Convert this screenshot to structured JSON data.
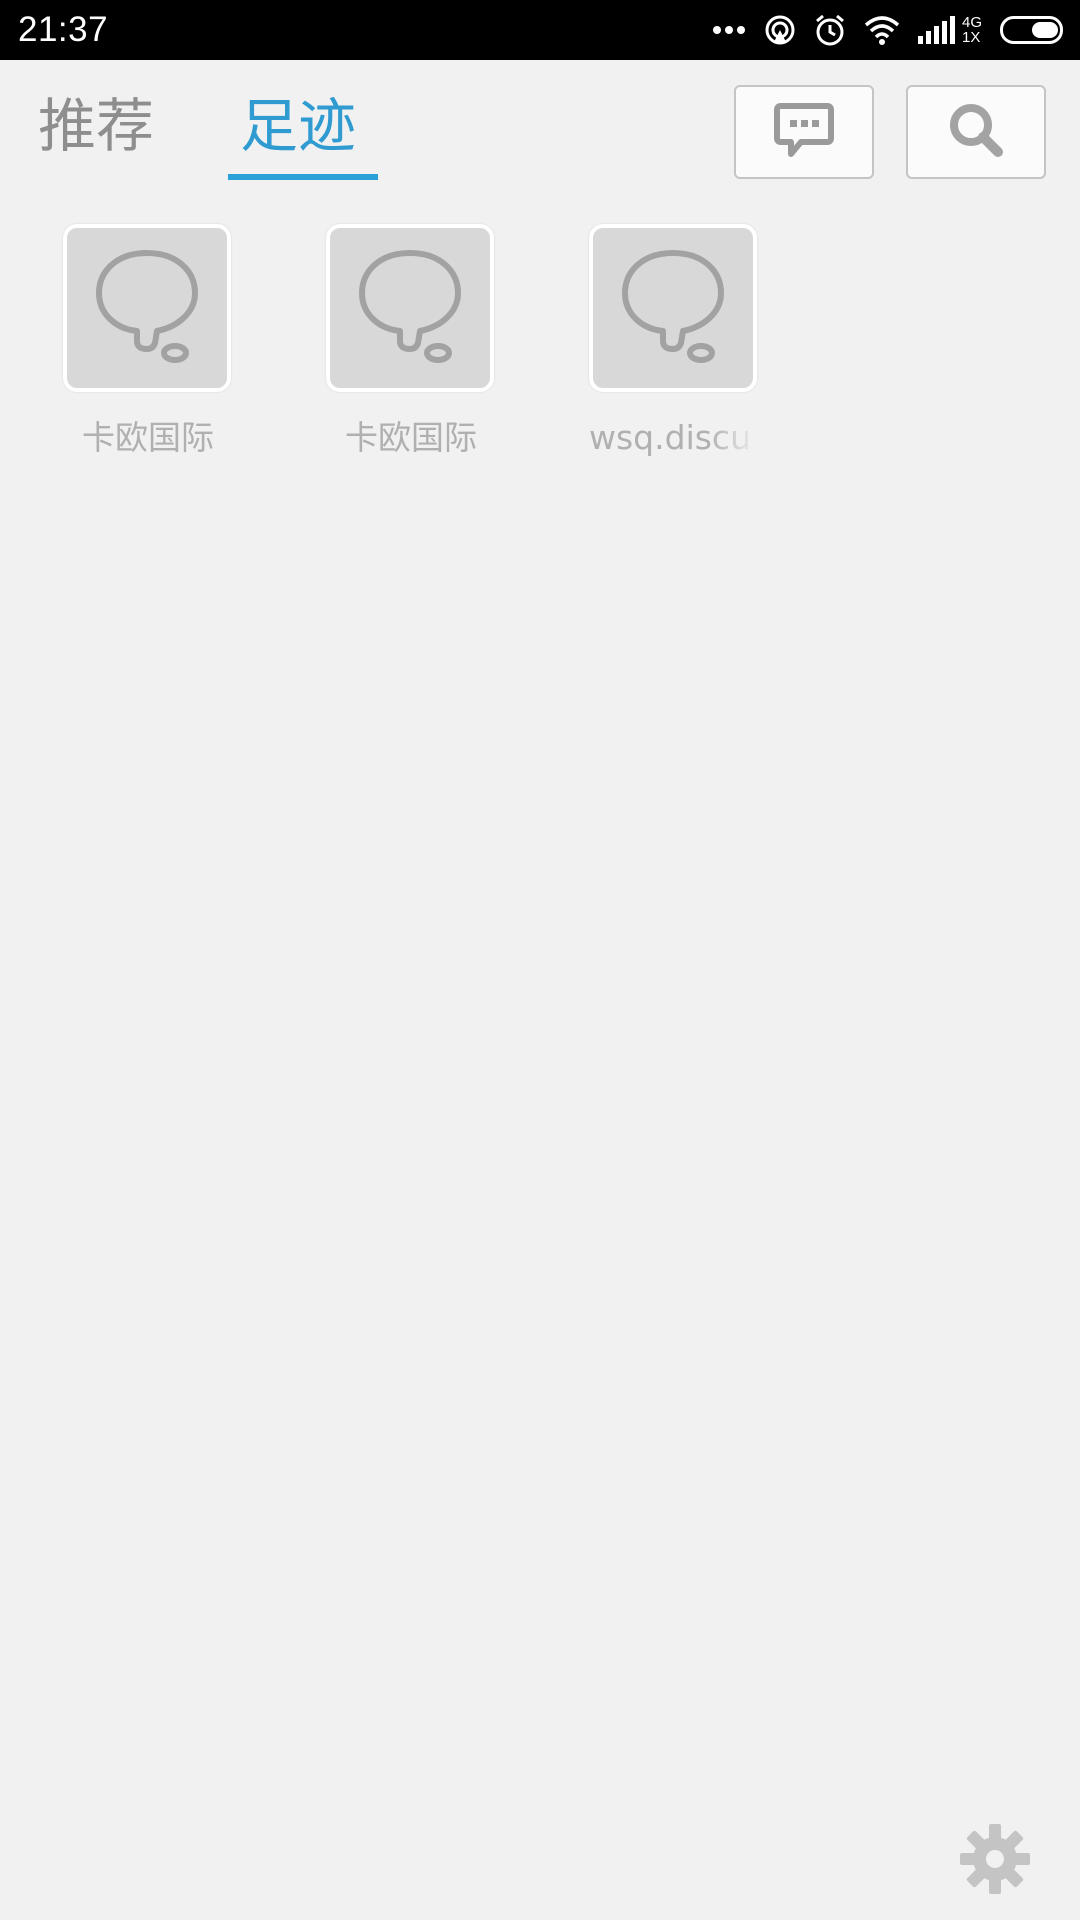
{
  "status_bar": {
    "time": "21:37",
    "network_top": "4G",
    "network_bottom": "1X",
    "icons": [
      "more-dots-icon",
      "hotspot-icon",
      "alarm-icon",
      "wifi-icon",
      "signal-icon",
      "battery-icon"
    ]
  },
  "tabs": [
    {
      "label": "推荐",
      "active": false
    },
    {
      "label": "足迹",
      "active": true
    }
  ],
  "toolbar": {
    "message_icon": "chat-bubble-icon",
    "search_icon": "search-icon"
  },
  "footprints": [
    {
      "label": "卡欧国际",
      "icon": "thought-bubble-icon"
    },
    {
      "label": "卡欧国际",
      "icon": "thought-bubble-icon"
    },
    {
      "label": "wsq.discu",
      "icon": "thought-bubble-icon"
    }
  ],
  "settings_icon": "gear-icon",
  "colors": {
    "accent": "#2f9bd1",
    "background": "#f1f1f1",
    "inactive_tab": "#8e8e8e"
  }
}
